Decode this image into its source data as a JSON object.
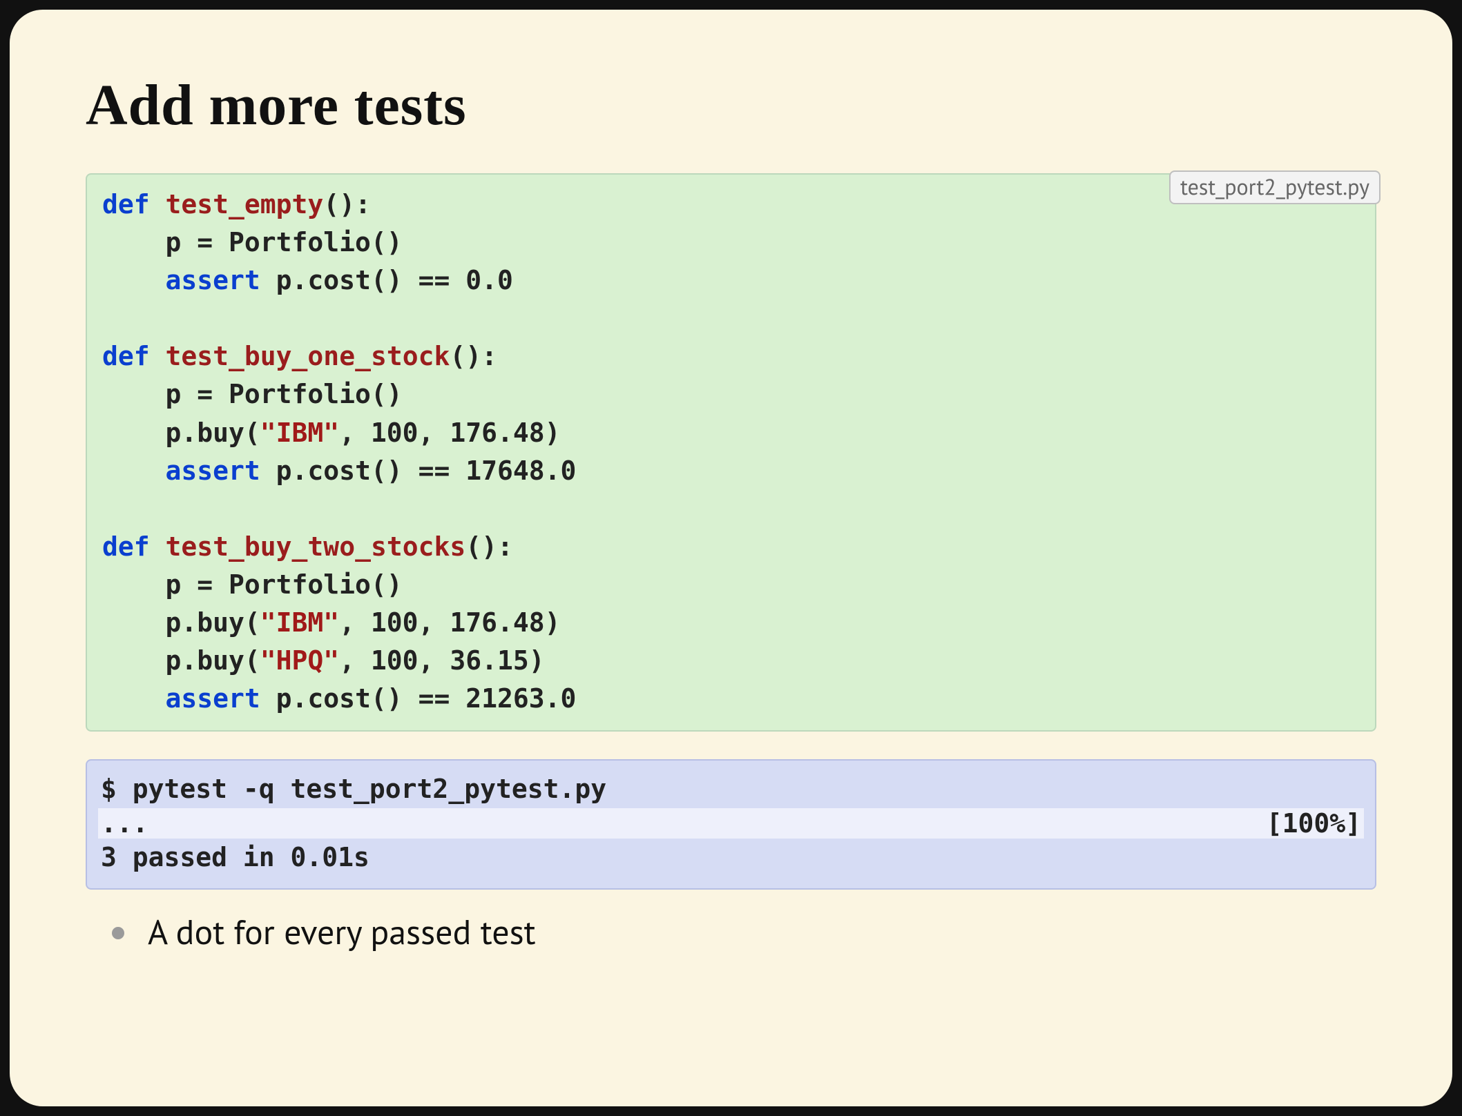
{
  "title": "Add more tests",
  "code": {
    "filename": "test_port2_pytest.py",
    "l1_def": "def",
    "l1_name": "test_empty",
    "l1_rest": "():",
    "l2": "    p = Portfolio()",
    "l3_kw": "assert",
    "l3_rest": " p.cost() == 0.0",
    "l5_def": "def",
    "l5_name": "test_buy_one_stock",
    "l5_rest": "():",
    "l6": "    p = Portfolio()",
    "l7a": "    p.buy(",
    "l7str": "\"IBM\"",
    "l7b": ", 100, 176.48)",
    "l8_kw": "assert",
    "l8_rest": " p.cost() == 17648.0",
    "l10_def": "def",
    "l10_name": "test_buy_two_stocks",
    "l10_rest": "():",
    "l11": "    p = Portfolio()",
    "l12a": "    p.buy(",
    "l12str": "\"IBM\"",
    "l12b": ", 100, 176.48)",
    "l13a": "    p.buy(",
    "l13str": "\"HPQ\"",
    "l13b": ", 100, 36.15)",
    "l14_kw": "assert",
    "l14_rest": " p.cost() == 21263.0"
  },
  "terminal": {
    "cmd": "$ pytest -q test_port2_pytest.py",
    "dots": "...",
    "pct": "[100%]",
    "summary": "3 passed in 0.01s"
  },
  "bullet": "A dot for every passed test"
}
